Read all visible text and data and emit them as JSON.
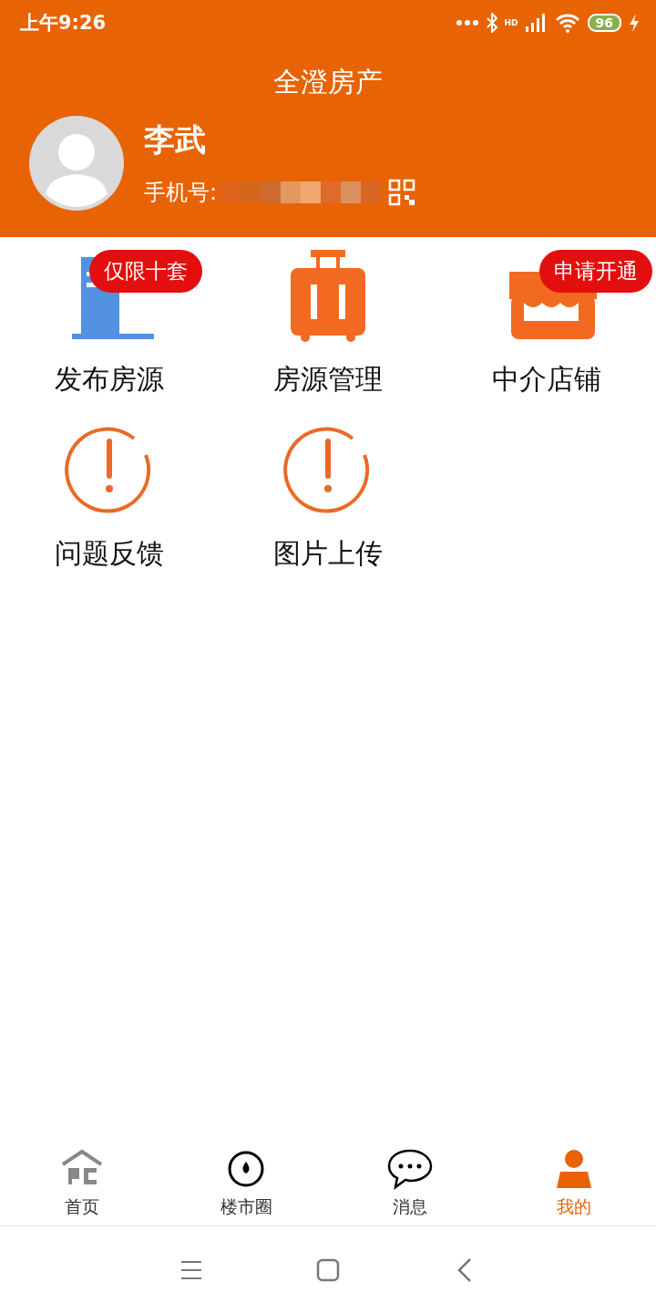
{
  "status_bar": {
    "time": "上午9:26",
    "network": "HD",
    "battery": "96"
  },
  "header": {
    "title": "全澄房产"
  },
  "profile": {
    "name": "李武",
    "phone_label": "手机号:"
  },
  "menu": [
    {
      "kind": "post",
      "label": "发布房源",
      "badge": "仅限十套"
    },
    {
      "kind": "manage",
      "label": "房源管理"
    },
    {
      "kind": "store",
      "label": "中介店铺",
      "badge": "申请开通"
    },
    {
      "kind": "alert",
      "label": "问题反馈"
    },
    {
      "kind": "alert",
      "label": "图片上传"
    }
  ],
  "tabs": [
    {
      "kind": "home",
      "label": "首页",
      "selected": false
    },
    {
      "kind": "circle",
      "label": "楼市圈",
      "selected": false
    },
    {
      "kind": "chat",
      "label": "消息",
      "selected": false
    },
    {
      "kind": "me",
      "label": "我的",
      "selected": true
    }
  ]
}
